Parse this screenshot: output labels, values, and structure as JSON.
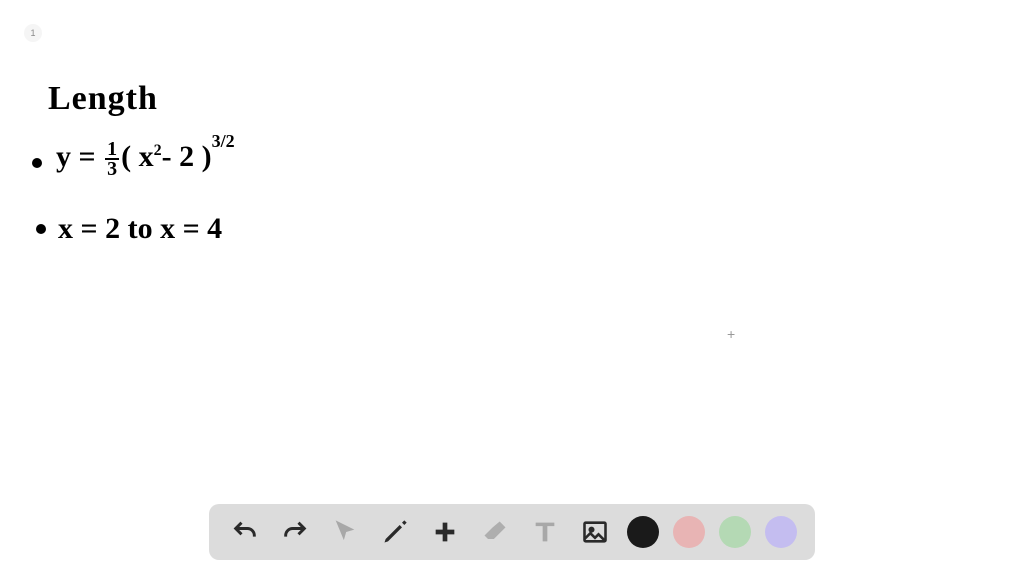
{
  "page": {
    "number": "1"
  },
  "notes": {
    "title": "Length",
    "equation1_prefix": "y = ",
    "equation1_frac_num": "1",
    "equation1_frac_den": "3",
    "equation1_paren_open": "( x",
    "equation1_inner_exp": "2",
    "equation1_minus": "- 2 )",
    "equation1_outer_exp": "3/2",
    "equation2": "x = 2   to   x = 4"
  },
  "toolbar": {
    "undo": "undo",
    "redo": "redo",
    "select": "select",
    "pen": "pen",
    "add": "add",
    "eraser": "eraser",
    "text": "text",
    "image": "image",
    "colors": {
      "black": "#1a1a1a",
      "pink": "#e8b4b4",
      "green": "#b4d9b4",
      "purple": "#c4bdf0"
    }
  },
  "cursor": {
    "symbol": "+"
  }
}
